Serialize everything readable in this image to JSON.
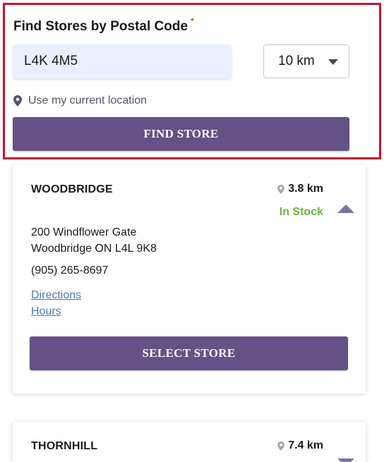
{
  "search": {
    "title": "Find Stores by Postal Code",
    "required_mark": "*",
    "postal_code_value": "L4K 4M5",
    "distance_selected": "10 km",
    "location_link": "Use my current location",
    "find_button": "FIND STORE"
  },
  "stores": [
    {
      "name": "WOODBRIDGE",
      "distance": "3.8 km",
      "stock_status": "In Stock",
      "address_line1": "200 Windflower Gate",
      "address_line2": "Woodbridge ON L4L 9K8",
      "phone": "(905) 265-8697",
      "directions_link": "Directions",
      "hours_link": "Hours",
      "select_button": "SELECT STORE",
      "expanded": true
    },
    {
      "name": "THORNHILL",
      "distance": "7.4 km",
      "expanded": false
    }
  ],
  "colors": {
    "brand_purple": "#645185",
    "in_stock_green": "#6bb33a",
    "link_blue": "#4c7bb3",
    "highlight_border": "#c8102e"
  },
  "icons": {
    "location": "map-pin-icon",
    "collapse": "triangle-up-icon",
    "expand": "triangle-down-icon",
    "dropdown": "caret-down-icon"
  }
}
